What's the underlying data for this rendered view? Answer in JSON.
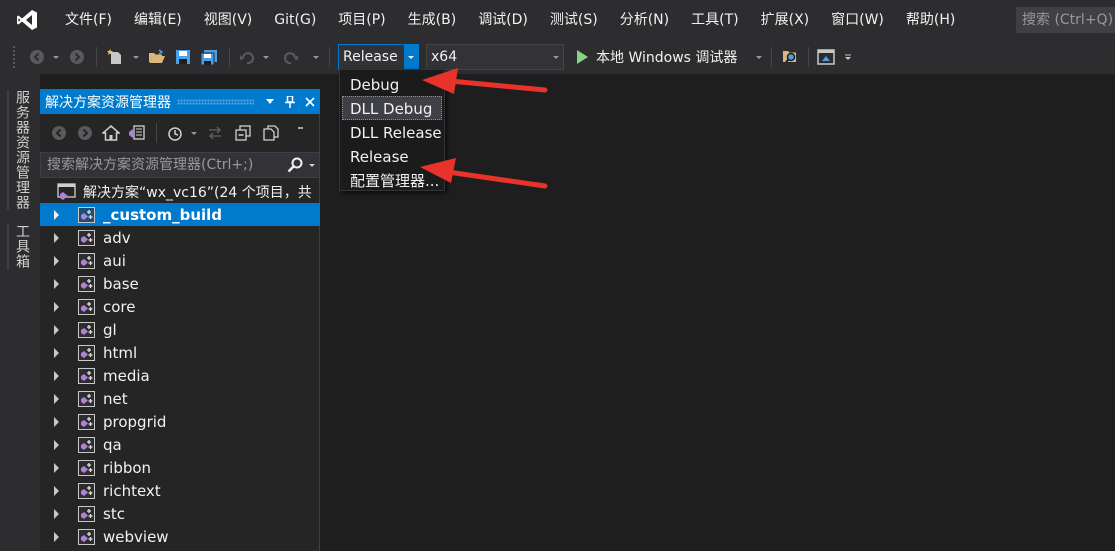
{
  "menu": {
    "items": [
      "文件(F)",
      "编辑(E)",
      "视图(V)",
      "Git(G)",
      "项目(P)",
      "生成(B)",
      "调试(D)",
      "测试(S)",
      "分析(N)",
      "工具(T)",
      "扩展(X)",
      "窗口(W)",
      "帮助(H)"
    ],
    "search_placeholder": "搜索 (Ctrl+Q)"
  },
  "toolbar": {
    "config_value": "Release",
    "platform_value": "x64",
    "run_label": "本地 Windows 调试器"
  },
  "config_dropdown": {
    "options": [
      "Debug",
      "DLL Debug",
      "DLL Release",
      "Release",
      "配置管理器..."
    ],
    "hovered": "DLL Debug"
  },
  "side_tabs": [
    "服务器资源管理器",
    "工具箱"
  ],
  "solution_explorer": {
    "title": "解决方案资源管理器",
    "search_placeholder": "搜索解决方案资源管理器(Ctrl+;)",
    "root_label": "解决方案“wx_vc16”(24 个项目，共",
    "projects": [
      "_custom_build",
      "adv",
      "aui",
      "base",
      "core",
      "gl",
      "html",
      "media",
      "net",
      "propgrid",
      "qa",
      "ribbon",
      "richtext",
      "stc",
      "webview"
    ],
    "selected": "_custom_build"
  },
  "colors": {
    "accent": "#007acc",
    "annotation_arrow": "#e8332a",
    "vs_purple": "#68217a"
  }
}
